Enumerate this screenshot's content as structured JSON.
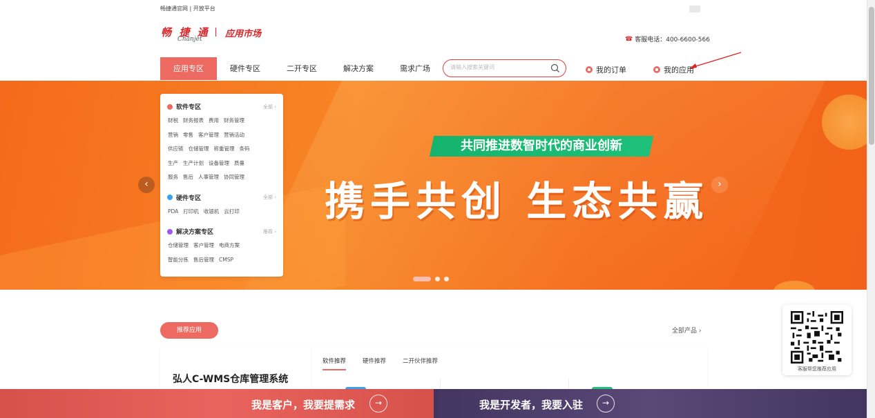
{
  "topbar": {
    "links": "畅捷通官网 | 开放平台"
  },
  "logo": {
    "main": "畅 捷 通",
    "sub": "Chanjet",
    "market": "应用市场"
  },
  "hotline": {
    "text": "客服电话：400-6600-566"
  },
  "nav": {
    "items": [
      {
        "label": "应用专区",
        "active": true
      },
      {
        "label": "硬件专区"
      },
      {
        "label": "二开专区"
      },
      {
        "label": "解决方案"
      },
      {
        "label": "需求广场"
      }
    ],
    "search_placeholder": "请输入搜索关键词",
    "my_orders": "我的订单",
    "my_apps": "我的应用"
  },
  "banner": {
    "tagline": "共同推进数智时代的商业创新",
    "title": "携手共创  生态共赢"
  },
  "categories": {
    "software": {
      "title": "软件专区",
      "more": "全部 ›",
      "rows": [
        [
          "财税",
          "财务报表",
          "费用",
          "财务管理"
        ],
        [
          "营销",
          "零售",
          "客户管理",
          "营销活动"
        ],
        [
          "供应链",
          "仓储管理",
          "称重管理",
          "条码"
        ],
        [
          "生产",
          "生产计划",
          "设备管理",
          "质量"
        ],
        [
          "服务",
          "售后",
          "人事管理",
          "协同管理"
        ]
      ]
    },
    "hardware": {
      "title": "硬件专区",
      "more": "全部 ›",
      "rows": [
        [
          "PDA",
          "打印机",
          "收银机",
          "云打印"
        ]
      ]
    },
    "solution": {
      "title": "解决方案专区",
      "more": "推荐 ›",
      "rows": [
        [
          "仓储管理",
          "客户管理",
          "电商方案"
        ],
        [
          "智能分拣",
          "售后管理",
          "CMSP"
        ]
      ]
    }
  },
  "recommend": {
    "button": "推荐应用",
    "all_products": "全部产品 ›",
    "featured_title": "弘人C-WMS仓库管理系统",
    "tabs": [
      "软件推荐",
      "硬件推荐",
      "二开伙伴推荐"
    ]
  },
  "qr": {
    "caption": "客服帮您推荐应用"
  },
  "bottom": {
    "customer": "我是客户，我要提需求",
    "developer": "我是开发者，我要入驻"
  },
  "colors": {
    "brand_red": "#d8262b",
    "nav_active": "#ec6a62",
    "banner_orange": "#f56a1c",
    "tag_green": "#16b36e",
    "dev_purple": "#43355f"
  }
}
